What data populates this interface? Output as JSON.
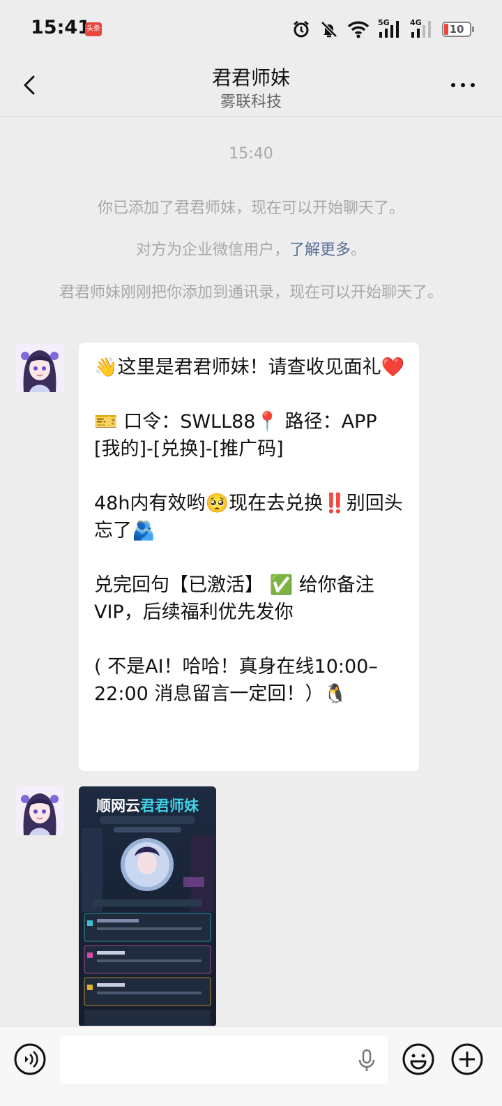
{
  "status_bar": {
    "time": "15:41",
    "app_badge": "头条",
    "network_1": "5G",
    "network_2": "4G",
    "battery": "10"
  },
  "header": {
    "title": "君君师妹",
    "subtitle": "雾联科技"
  },
  "chat": {
    "timestamp": "15:40",
    "system_1": "你已添加了君君师妹，现在可以开始聊天了。",
    "system_2_prefix": "对方为企业微信用户，",
    "system_2_link": "了解更多",
    "system_2_suffix": "。",
    "system_3": "君君师妹刚刚把你添加到通讯录，现在可以开始聊天了。",
    "message": {
      "p1_a": "👋这里是君君师妹！请查收见面礼",
      "p1_b": "❤️",
      "p2_a": "🎫 口令：SWLL88📍 路径：APP [我的]-[兑换]-[推广码]",
      "p3_a": "48h内有效哟🥺现在去兑换‼️别回头忘了🫂",
      "p4_a": "兑完回句【已激活】 ✅ 给你备注VIP，后续福利优先发你",
      "p5_a": "( 不是AI！哈哈！真身在线10:00–22:00 消息留言一定回！）🐧"
    },
    "poster": {
      "title_a": "顺网云",
      "title_b": "君君师妹"
    }
  },
  "colors": {
    "background": "#ededed",
    "bubble": "#ffffff",
    "link": "#576b95",
    "system_text": "#a8a8a8"
  },
  "icons": [
    "back-arrow-icon",
    "more-icon",
    "voice-icon",
    "mic-icon",
    "emoji-icon",
    "plus-icon"
  ]
}
